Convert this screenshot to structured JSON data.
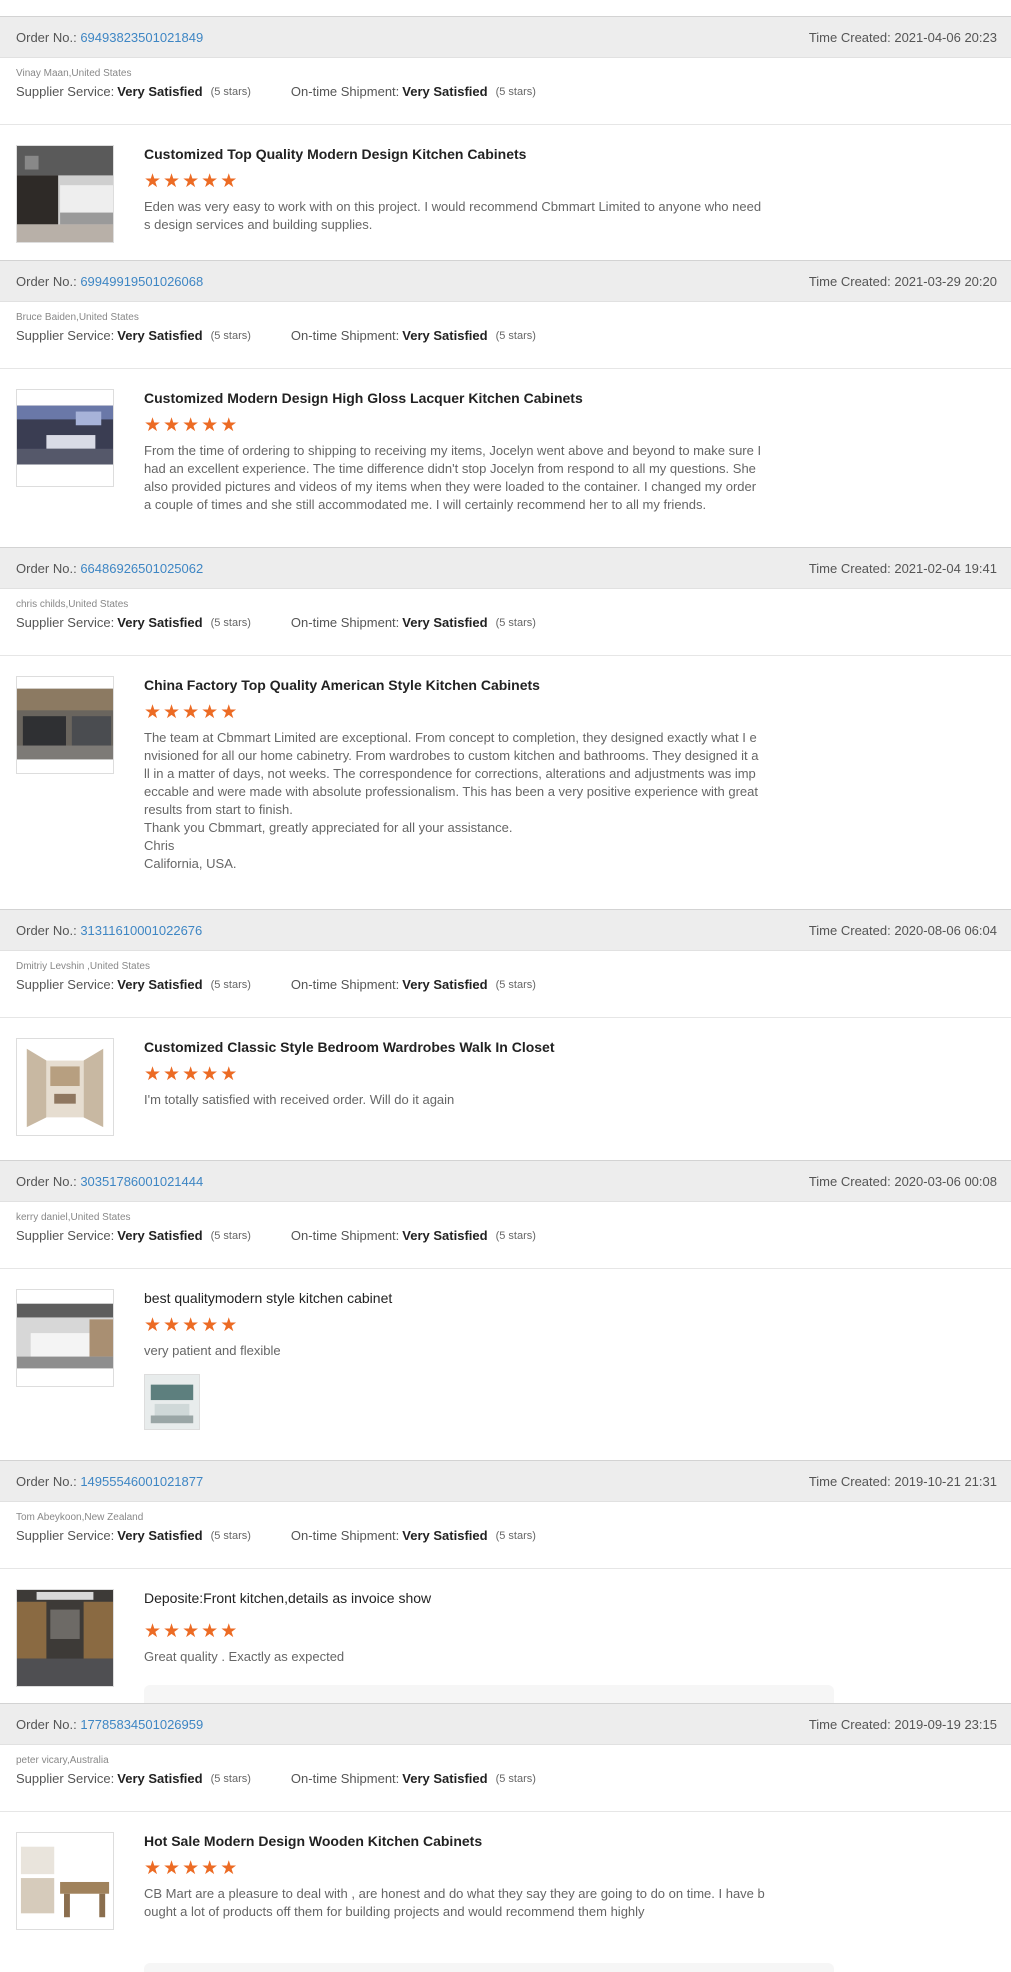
{
  "labels": {
    "order_no": "Order No.:",
    "time_created": "Time Created:",
    "supplier_service": "Supplier Service:",
    "on_time_shipment": "On-time Shipment:"
  },
  "colors": {
    "accent_star": "#ec6b24",
    "link": "#3e86c4"
  },
  "reviews": [
    {
      "order_no": "69493823501021849",
      "time": "2021-04-06 20:23",
      "buyer": "Vinay Maan,United States",
      "supplier_service": "Very Satisfied",
      "supplier_stars": "(5 stars)",
      "shipment": "Very Satisfied",
      "shipment_stars": "(5 stars)",
      "product_title": "Customized Top Quality Modern Design Kitchen Cabinets",
      "rating": 5,
      "comment": "Eden was very easy to work with on this project. I would recommend Cbmmart Limited to anyone who need\ns design services and building supplies."
    },
    {
      "order_no": "69949919501026068",
      "time": "2021-03-29 20:20",
      "buyer": "Bruce Baiden,United States",
      "supplier_service": "Very Satisfied",
      "supplier_stars": "(5 stars)",
      "shipment": "Very Satisfied",
      "shipment_stars": "(5 stars)",
      "product_title": "Customized Modern Design High Gloss Lacquer Kitchen Cabinets",
      "rating": 5,
      "comment": "From the time of ordering to shipping to receiving my items, Jocelyn went above and beyond to make sure I\nhad an excellent experience. The time difference didn't stop Jocelyn from respond to all my questions. She\nalso provided pictures and videos of my items when they were loaded to the container. I changed my order\na couple of times and she still accommodated me. I will certainly recommend her to all my friends."
    },
    {
      "order_no": "66486926501025062",
      "time": "2021-02-04 19:41",
      "buyer": "chris childs,United States",
      "supplier_service": "Very Satisfied",
      "supplier_stars": "(5 stars)",
      "shipment": "Very Satisfied",
      "shipment_stars": "(5 stars)",
      "product_title": "China Factory Top Quality American Style Kitchen Cabinets",
      "rating": 5,
      "comment": "The team at Cbmmart Limited are exceptional. From concept to completion, they designed exactly what I e\nnvisioned for all our home cabinetry. From wardrobes to custom kitchen and bathrooms. They designed it a\nll in a matter of days, not weeks. The correspondence for corrections, alterations and adjustments was imp\neccable and were made with absolute professionalism. This has been a very positive experience with great\nresults from start to finish.\nThank you Cbmmart, greatly appreciated for all your assistance.\nChris\nCalifornia, USA."
    },
    {
      "order_no": "31311610001022676",
      "time": "2020-08-06 06:04",
      "buyer": "Dmitriy Levshin ,United States",
      "supplier_service": "Very Satisfied",
      "supplier_stars": "(5 stars)",
      "shipment": "Very Satisfied",
      "shipment_stars": "(5 stars)",
      "product_title": "Customized Classic Style Bedroom Wardrobes Walk In Closet",
      "rating": 5,
      "comment": "I'm totally satisfied with received order. Will do it again"
    },
    {
      "order_no": "30351786001021444",
      "time": "2020-03-06 00:08",
      "buyer": "kerry daniel,United States",
      "supplier_service": "Very Satisfied",
      "supplier_stars": "(5 stars)",
      "shipment": "Very Satisfied",
      "shipment_stars": "(5 stars)",
      "product_title": "best qualitymodern style kitchen cabinet",
      "rating": 5,
      "comment": "very patient and flexible"
    },
    {
      "order_no": "14955546001021877",
      "time": "2019-10-21 21:31",
      "buyer": "Tom Abeykoon,New Zealand",
      "supplier_service": "Very Satisfied",
      "supplier_stars": "(5 stars)",
      "shipment": "Very Satisfied",
      "shipment_stars": "(5 stars)",
      "product_title": "Deposite:Front kitchen,details as invoice show",
      "rating": 5,
      "comment": "Great quality . Exactly as expected"
    },
    {
      "order_no": "17785834501026959",
      "time": "2019-09-19 23:15",
      "buyer": "peter vicary,Australia",
      "supplier_service": "Very Satisfied",
      "supplier_stars": "(5 stars)",
      "shipment": "Very Satisfied",
      "shipment_stars": "(5 stars)",
      "product_title": "Hot Sale Modern Design Wooden Kitchen Cabinets",
      "rating": 5,
      "comment": "CB Mart are a pleasure to deal with , are honest and do what they say they are going to do on time. I have b\nought a lot of products off them for building projects and would recommend them highly"
    }
  ]
}
